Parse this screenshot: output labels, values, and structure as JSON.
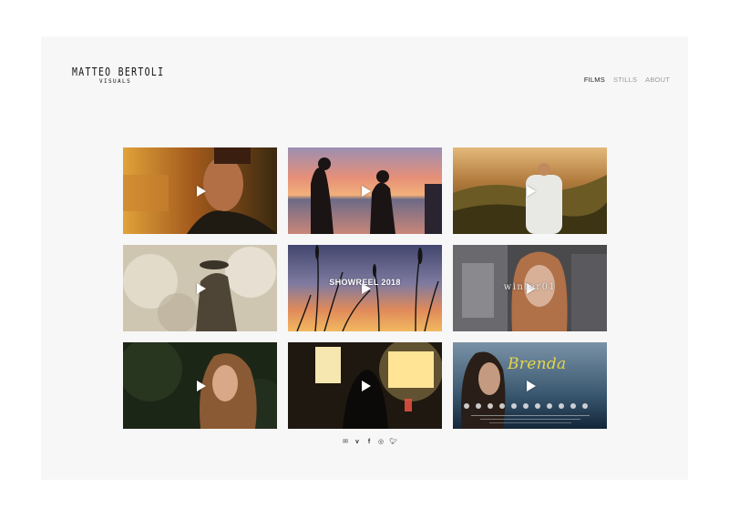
{
  "brand": {
    "name": "MATTEO BERTOLI",
    "subtitle": "VISUALS"
  },
  "nav": {
    "items": [
      {
        "label": "FILMS",
        "active": true
      },
      {
        "label": "STILLS",
        "active": false
      },
      {
        "label": "ABOUT",
        "active": false
      }
    ]
  },
  "grid": {
    "tiles": [
      {
        "caption": ""
      },
      {
        "caption": ""
      },
      {
        "caption": ""
      },
      {
        "caption": ""
      },
      {
        "caption": "SHOWREEL 2018"
      },
      {
        "caption": "winter01"
      },
      {
        "caption": ""
      },
      {
        "caption": ""
      },
      {
        "caption": "Brenda"
      }
    ]
  },
  "social": {
    "icons": [
      "mail-icon",
      "vimeo-icon",
      "facebook-icon",
      "instagram-icon",
      "twitter-icon"
    ]
  }
}
